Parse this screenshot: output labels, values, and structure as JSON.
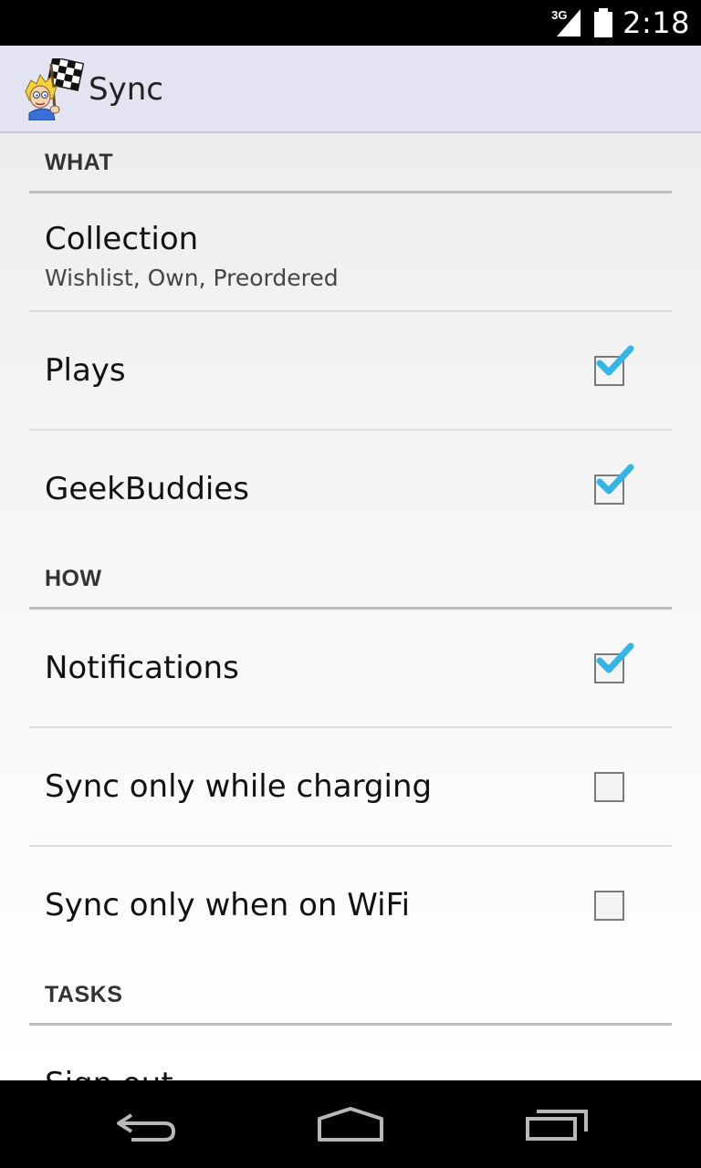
{
  "status_bar": {
    "network": "3G",
    "time": "2:18"
  },
  "action_bar": {
    "title": "Sync"
  },
  "sections": [
    {
      "header": "WHAT",
      "items": [
        {
          "title": "Collection",
          "summary": "Wishlist, Own, Preordered"
        },
        {
          "title": "Plays",
          "checked": true
        },
        {
          "title": "GeekBuddies",
          "checked": true
        }
      ]
    },
    {
      "header": "HOW",
      "items": [
        {
          "title": "Notifications",
          "checked": true
        },
        {
          "title": "Sync only while charging",
          "checked": false
        },
        {
          "title": "Sync only when on WiFi",
          "checked": false
        }
      ]
    },
    {
      "header": "TASKS",
      "items": [
        {
          "title": "Sign out"
        }
      ]
    }
  ],
  "colors": {
    "action_bar_bg": "#e3e3f2",
    "check_accent": "#33b5e5",
    "divider": "#bdbdbd"
  },
  "nav_icons": [
    "back-icon",
    "home-icon",
    "recent-apps-icon"
  ]
}
